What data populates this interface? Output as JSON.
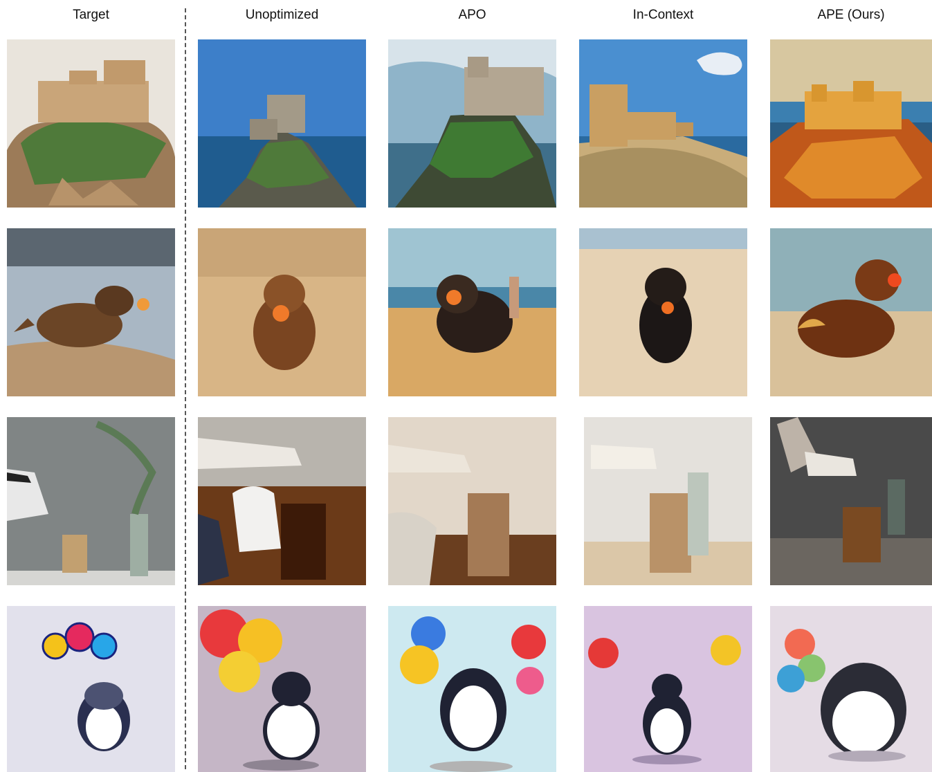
{
  "headers": {
    "target": "Target",
    "unoptimized": "Unoptimized",
    "apo": "APO",
    "in_context": "In-Context",
    "ape": "APE (Ours)"
  },
  "rows": [
    {
      "subject": "cliff-castle"
    },
    {
      "subject": "dachshund-beach"
    },
    {
      "subject": "pouring-milk-coffee"
    },
    {
      "subject": "penguin-balloons"
    }
  ],
  "colors": {
    "sky_blue": "#3d7fc9",
    "sea_blue": "#1f5c8f",
    "sand": "#d9b27a",
    "golden": "#e8962a",
    "lavender": "#d9c4e0",
    "penguin_black": "#1f2233"
  }
}
